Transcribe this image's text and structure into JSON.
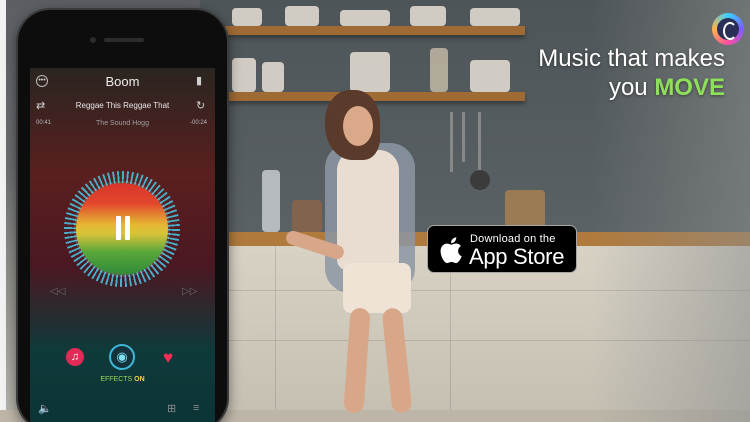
{
  "promo": {
    "headline_line1": "Music that makes",
    "headline_line2_prefix": "you ",
    "headline_emphasis": "MOVE"
  },
  "app_store_badge": {
    "small_text": "Download on the",
    "big_text": "App Store"
  },
  "player": {
    "screen_title": "Boom",
    "song_title": "Reggae This Reggae That",
    "artist": "The Sound Hogg",
    "elapsed": "00:41",
    "remaining": "-00:24",
    "effects_label": "EFFECTS",
    "effects_state": "ON"
  },
  "icons": {
    "menu": "ellipsis-circle-icon",
    "cart": "bag-icon",
    "shuffle": "shuffle-icon",
    "repeat": "repeat-icon",
    "play_pause": "pause-icon",
    "rewind": "rewind-icon",
    "fast_forward": "fast-forward-icon",
    "music": "music-note-icon",
    "effects": "microphone-icon",
    "favorite": "heart-icon",
    "volume": "speaker-icon",
    "add_to_playlist": "add-icon",
    "queue": "queue-icon",
    "brand": "app-logo-icon"
  },
  "colors": {
    "accent_green": "#8ee05a",
    "effects_on": "#f5d04a",
    "heart": "#ff2d55",
    "music_button": "#e02b57",
    "effects_ring": "#3fb8d8"
  }
}
